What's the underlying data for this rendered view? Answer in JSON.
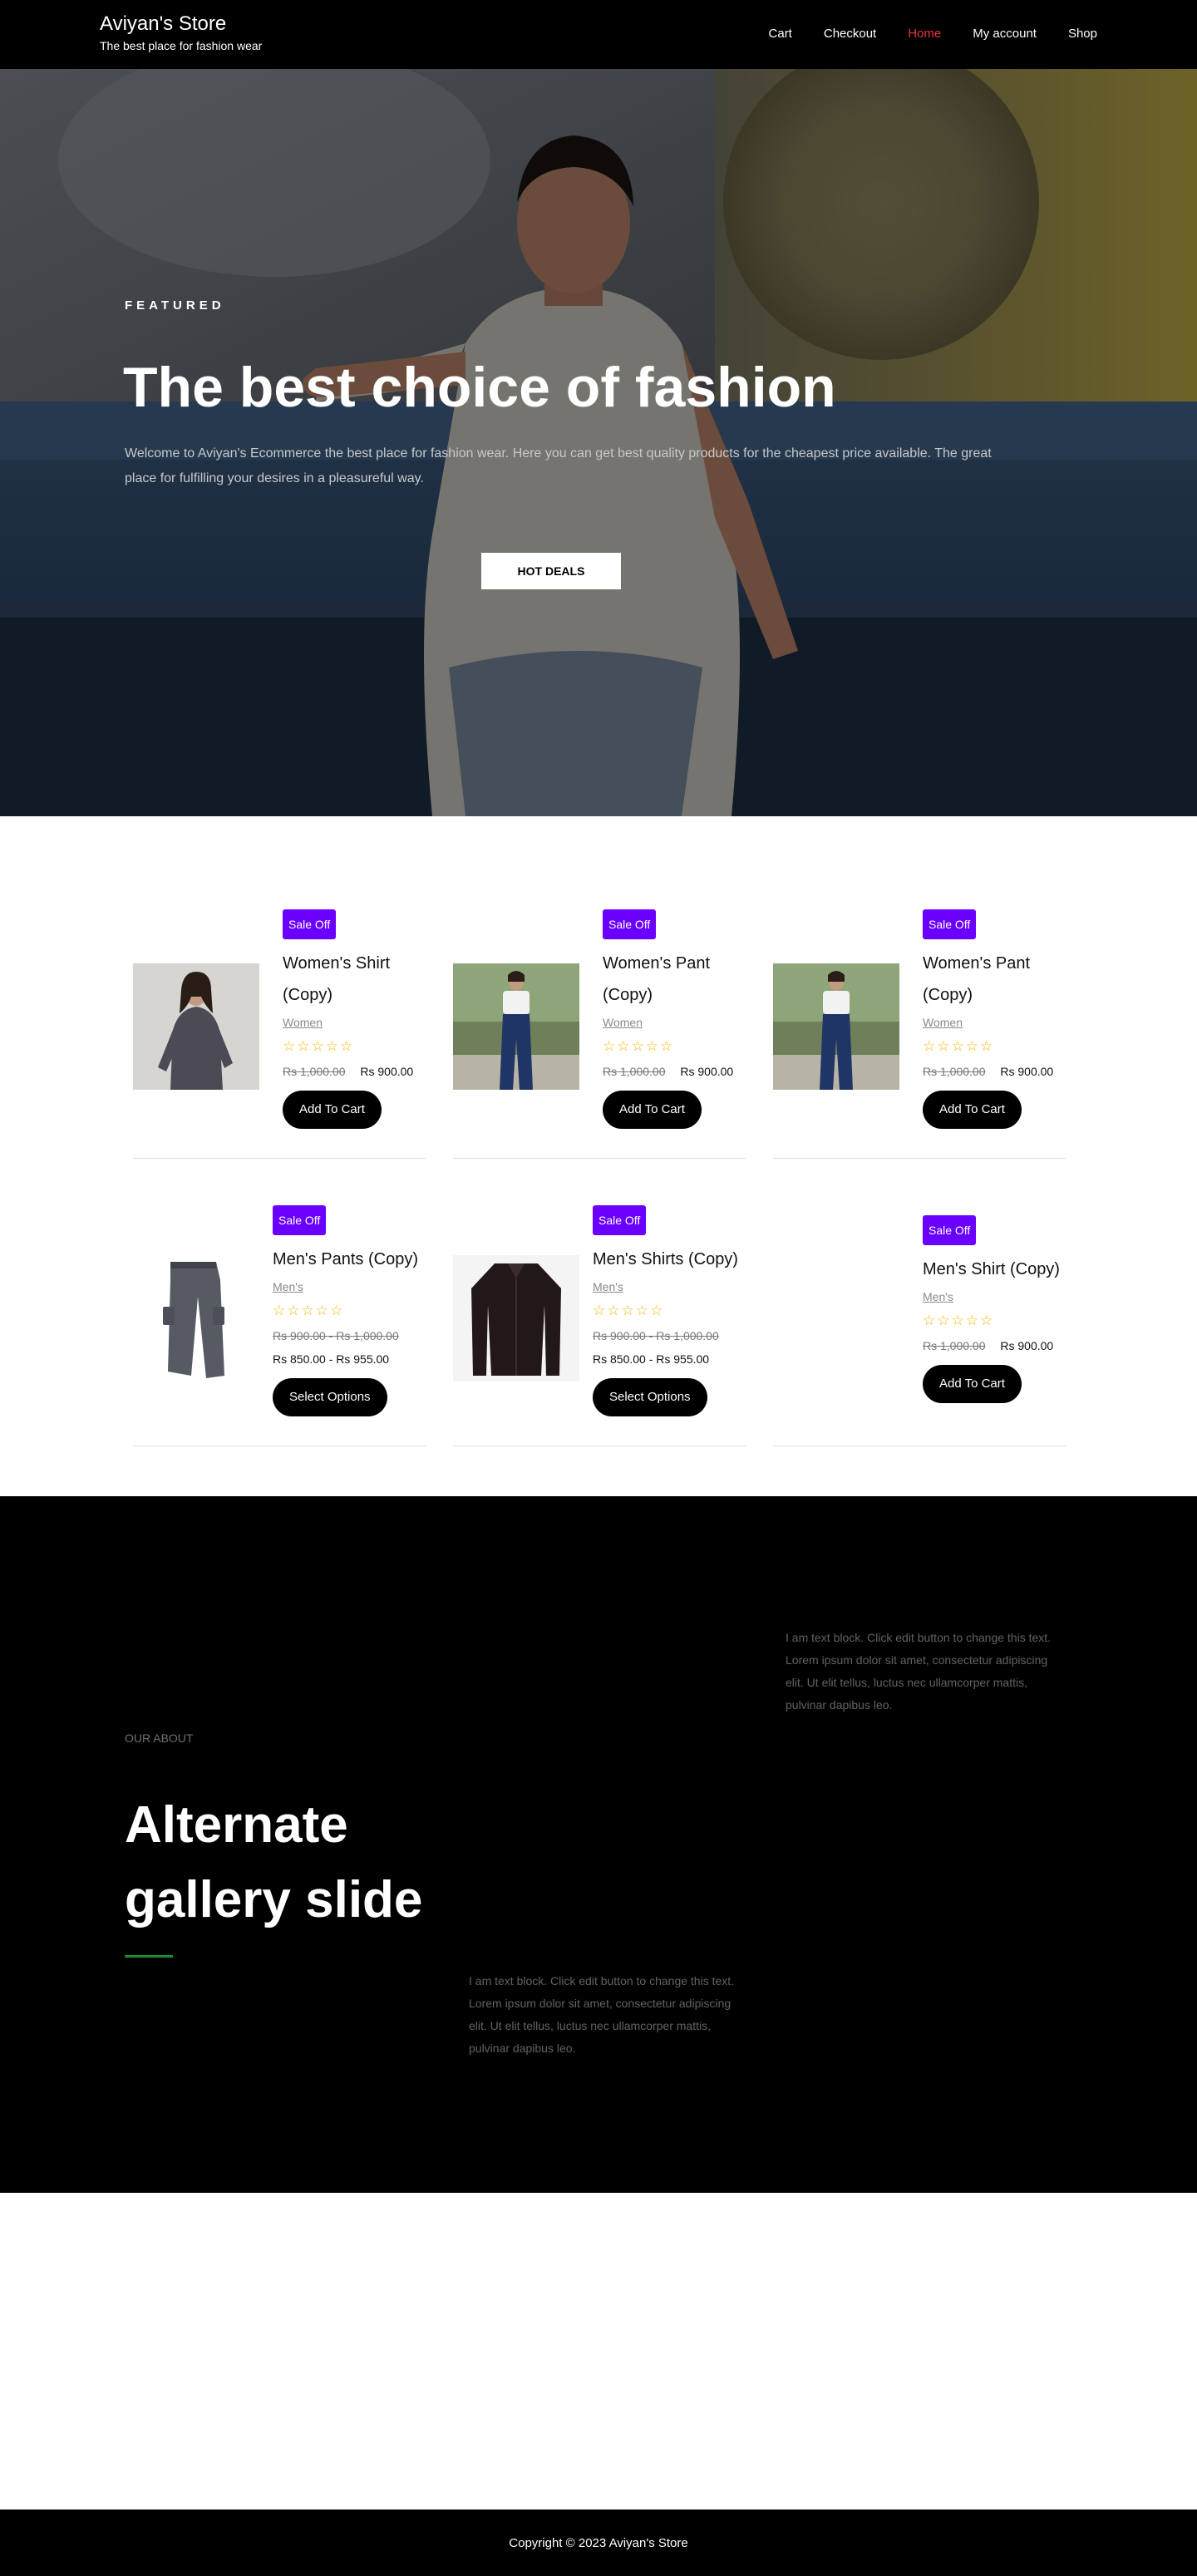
{
  "site": {
    "title": "Aviyan's Store",
    "tagline": "The best place for fashion wear"
  },
  "nav": {
    "items": [
      {
        "label": "Cart"
      },
      {
        "label": "Checkout"
      },
      {
        "label": "Home",
        "active": true
      },
      {
        "label": "My account"
      },
      {
        "label": "Shop"
      }
    ]
  },
  "hero": {
    "eyebrow": "FEATURED",
    "title": "The best choice of fashion",
    "text": "Welcome to Aviyan's Ecommerce the best place for fashion wear. Here you can get best quality products for the cheapest price available. The great place for fulfilling your desires in a pleasureful way.",
    "cta": "HOT DEALS"
  },
  "products": [
    {
      "badge": "Sale Off",
      "title": "Women's Shirt (Copy)",
      "category": "Women",
      "rating": 0,
      "old_price": "Rs 1,000.00",
      "price": "Rs 900.00",
      "button": "Add To Cart",
      "image": "woman-grey-shirt"
    },
    {
      "badge": "Sale Off",
      "title": "Women's Pant (Copy)",
      "category": "Women",
      "rating": 0,
      "old_price": "Rs 1,000.00",
      "price": "Rs 900.00",
      "button": "Add To Cart",
      "image": "woman-jeans"
    },
    {
      "badge": "Sale Off",
      "title": "Women's Pant (Copy)",
      "category": "Women",
      "rating": 0,
      "old_price": "Rs 1,000.00",
      "price": "Rs 900.00",
      "button": "Add To Cart",
      "image": "woman-jeans"
    },
    {
      "badge": "Sale Off",
      "title": "Men's Pants (Copy)",
      "category": "Men's",
      "rating": 0,
      "old_price_range": "Rs 900.00 - Rs 1,000.00",
      "price_range": "Rs 850.00 - Rs 955.00",
      "button": "Select Options",
      "image": "grey-cargo-pants"
    },
    {
      "badge": "Sale Off",
      "title": "Men's Shirts (Copy)",
      "category": "Men's",
      "rating": 0,
      "old_price_range": "Rs 900.00 - Rs 1,000.00",
      "price_range": "Rs 850.00 - Rs 955.00",
      "button": "Select Options",
      "image": "dark-shirt"
    },
    {
      "badge": "Sale Off",
      "title": "Men's Shirt (Copy)",
      "category": "Men's",
      "rating": 0,
      "old_price": "Rs 1,000.00",
      "price": "Rs 900.00",
      "button": "Add To Cart",
      "image": "none"
    }
  ],
  "stars": "☆☆☆☆☆",
  "about": {
    "eyebrow": "OUR ABOUT",
    "title_line1": "Alternate",
    "title_line2": "gallery slide",
    "text1": "I am text block. Click edit button to change this text. Lorem ipsum dolor sit amet, consectetur adipiscing elit. Ut elit tellus, luctus nec ullamcorper mattis, pulvinar dapibus leo.",
    "text2": "I am text block. Click edit button to change this text. Lorem ipsum dolor sit amet, consectetur adipiscing elit. Ut elit tellus, luctus nec ullamcorper mattis, pulvinar dapibus leo.",
    "accent_color": "#198c2b"
  },
  "footer": {
    "copyright": "Copyright © 2023 Aviyan's Store"
  },
  "colors": {
    "nav_active": "#e73540",
    "badge": "#6a00ff",
    "star": "#f2b600"
  }
}
